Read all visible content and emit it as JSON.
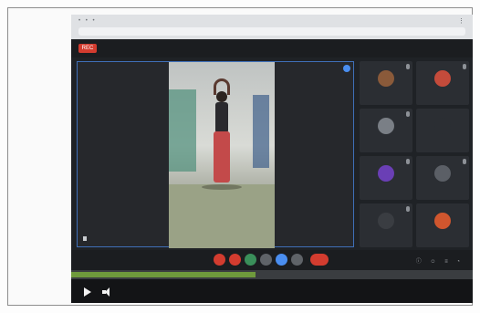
{
  "meeting": {
    "rec_label": "REC",
    "title": "",
    "people_label": ""
  },
  "stage": {
    "presenter_name": ""
  },
  "participants": [
    {
      "name": "",
      "initial": "",
      "color": "#8a5a3a"
    },
    {
      "name": "",
      "initial": "",
      "color": "#c44b3b"
    },
    {
      "name": "",
      "initial": "",
      "color": "#7a7f86"
    },
    {
      "name": "",
      "initial": "",
      "color": "#2b2e33"
    },
    {
      "name": "",
      "initial": "",
      "color": "#6a3fb5"
    },
    {
      "name": "",
      "initial": "",
      "color": "#5b5f66"
    },
    {
      "name": "",
      "initial": "",
      "color": "#3a3d42"
    },
    {
      "name": "",
      "initial": "",
      "color": "#d0562e"
    }
  ],
  "controls": {
    "meeting_info": "",
    "button_colors": [
      "#d33c2f",
      "#d33c2f",
      "#3a8f5a",
      "#5f6368",
      "#4a8ef0",
      "#5f6368",
      "#d33c2f"
    ]
  },
  "player": {
    "progress": 0.46,
    "time": "",
    "track_color": "#6f9a3c"
  },
  "colors": {
    "accent_blue": "#4a8ef0",
    "record_red": "#d33c2f"
  }
}
